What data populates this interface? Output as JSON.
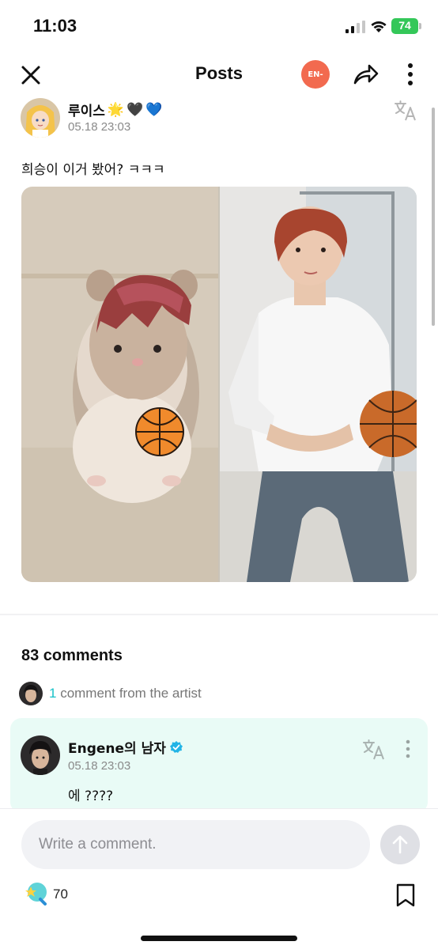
{
  "status_bar": {
    "time": "11:03",
    "battery": "74"
  },
  "nav": {
    "title": "Posts",
    "logo_text": "EN-"
  },
  "post": {
    "author_name": "루이스",
    "author_emojis": [
      "🌟",
      "🖤",
      "💙"
    ],
    "date": "05.18 23:03",
    "text": "희승이 이거 봤어? ㅋㅋㅋ"
  },
  "comments": {
    "count_label": "83 comments",
    "artist_count": "1",
    "artist_label": " comment from the artist",
    "artist_comment": {
      "name": "Engene의 남자",
      "date": "05.18 23:03",
      "body": "에 ????"
    }
  },
  "bottom": {
    "input_placeholder": "Write a comment.",
    "reaction_count": "70"
  },
  "colors": {
    "accent": "#17c1c8",
    "artist_bg": "#e9fbf6",
    "logo": "#f26a4f",
    "battery": "#34c759"
  }
}
